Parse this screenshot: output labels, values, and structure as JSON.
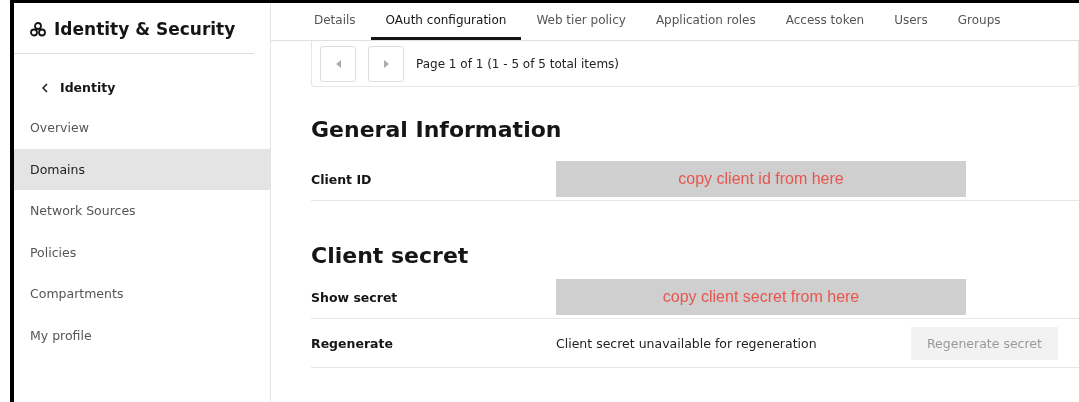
{
  "sidebar": {
    "title": "Identity & Security",
    "back_link": "Identity",
    "items": [
      {
        "label": "Overview",
        "selected": false
      },
      {
        "label": "Domains",
        "selected": true
      },
      {
        "label": "Network Sources",
        "selected": false
      },
      {
        "label": "Policies",
        "selected": false
      },
      {
        "label": "Compartments",
        "selected": false
      },
      {
        "label": "My profile",
        "selected": false
      }
    ]
  },
  "tabs": [
    {
      "label": "Details",
      "selected": false
    },
    {
      "label": "OAuth configuration",
      "selected": true
    },
    {
      "label": "Web tier policy",
      "selected": false
    },
    {
      "label": "Application roles",
      "selected": false
    },
    {
      "label": "Access token",
      "selected": false
    },
    {
      "label": "Users",
      "selected": false
    },
    {
      "label": "Groups",
      "selected": false
    }
  ],
  "pager": {
    "text": "Page 1 of 1 (1 - 5 of 5 total items)",
    "prev_disabled": true,
    "next_disabled": true
  },
  "sections": [
    {
      "heading": "General Information",
      "rows": [
        {
          "kind": "note",
          "label": "Client ID",
          "note": "copy client id from here"
        }
      ]
    },
    {
      "heading": "Client secret",
      "rows": [
        {
          "kind": "note",
          "label": "Show secret",
          "note": "copy client secret from here"
        },
        {
          "kind": "action",
          "label": "Regenerate",
          "text": "Client secret unavailable for regeneration",
          "button": "Regenerate secret",
          "disabled": true
        }
      ]
    }
  ]
}
